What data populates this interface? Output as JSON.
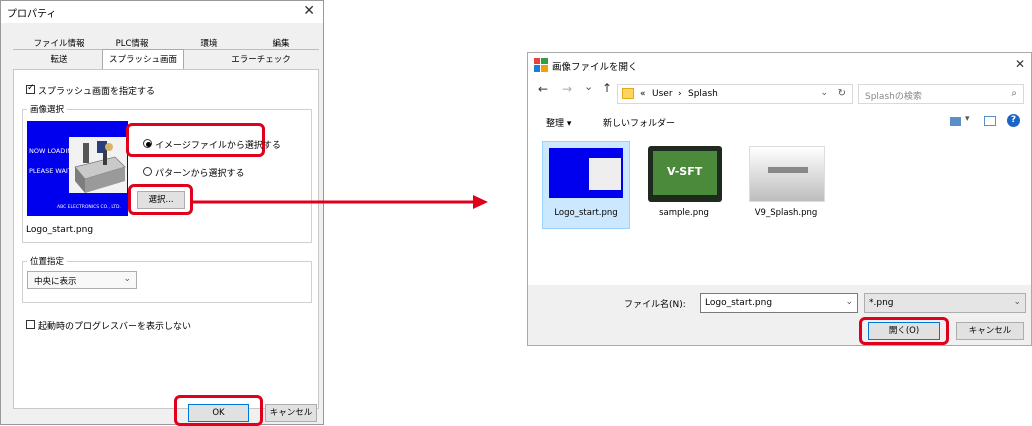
{
  "properties_dialog": {
    "title": "プロパティ",
    "close_glyph": "✕",
    "tabs_row1": [
      "ファイル情報",
      "PLC情報",
      "環境",
      "編集"
    ],
    "tabs_row2": [
      "転送",
      "スプラッシュ画面",
      "エラーチェック"
    ],
    "active_tab": "スプラッシュ画面",
    "enable_splash_label": "スプラッシュ画面を指定する",
    "enable_splash_checked": true,
    "image_select_group": "画像選択",
    "radio_image_file": "イメージファイルから選択する",
    "radio_pattern": "パターンから選択する",
    "selected_radio": "radio_image_file",
    "select_button": "選択...",
    "preview": {
      "line1": "NOW LOADING",
      "line2": "PLEASE WAIT",
      "company": "ABC ELECTRONICS CO., LTD."
    },
    "file_name": "Logo_start.png",
    "position_group": "位置指定",
    "position_value": "中央に表示",
    "progress_bar_label": "起動時のプログレスバーを表示しない",
    "progress_bar_checked": false,
    "ok_button": "OK",
    "cancel_button": "キャンセル"
  },
  "open_dialog": {
    "title": "画像ファイルを開く",
    "close_glyph": "✕",
    "nav": {
      "back": "←",
      "forward": "→",
      "recent": "⌄",
      "up": "↑"
    },
    "breadcrumb": {
      "overflow": "«",
      "user": "User",
      "sep": "›",
      "folder": "Splash"
    },
    "refresh_glyph": "↻",
    "search_placeholder": "Splashの検索",
    "toolbar": {
      "organize": "整理 ▾",
      "new_folder": "新しいフォルダー"
    },
    "files": [
      {
        "name": "Logo_start.png",
        "selected": true
      },
      {
        "name": "sample.png",
        "selected": false
      },
      {
        "name": "V9_Splash.png",
        "selected": false
      }
    ],
    "sample_thumb_text": "V-SFT",
    "file_name_label": "ファイル名(N):",
    "file_name_value": "Logo_start.png",
    "file_type_value": "*.png",
    "open_button": "開く(O)",
    "cancel_button": "キャンセル"
  },
  "colors": {
    "highlight_red": "#e0001b",
    "splash_blue": "#0000ee",
    "selection_blue": "#cce8ff",
    "arrow_red": "#e0001b"
  }
}
